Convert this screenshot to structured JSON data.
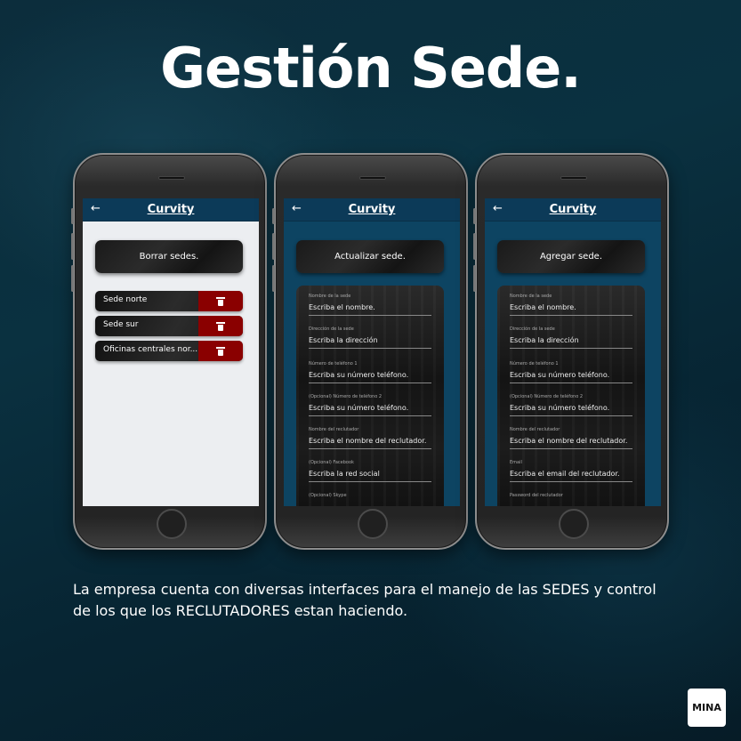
{
  "headline": "Gestión Sede.",
  "caption": "La empresa cuenta con diversas interfaces para el manejo de las SEDES y control de los que los RECLUTADORES estan haciendo.",
  "logo_text": "MINA",
  "phones": [
    {
      "app_title": "Curvity",
      "back_icon": "←",
      "action_button": "Borrar sedes.",
      "sedes": [
        "Sede norte",
        "Sede sur",
        "Oficinas centrales nor..."
      ]
    },
    {
      "app_title": "Curvity",
      "back_icon": "←",
      "action_button": "Actualizar sede.",
      "fields": [
        {
          "label": "Nombre de la sede",
          "placeholder": "Escriba el nombre."
        },
        {
          "label": "Dirección de la sede",
          "placeholder": "Escriba la dirección"
        },
        {
          "label": "Número de teléfono 1",
          "placeholder": "Escriba su número teléfono."
        },
        {
          "label": "(Opcional) Número de teléfono 2",
          "placeholder": "Escriba su número teléfono."
        },
        {
          "label": "Nombre del reclutador",
          "placeholder": "Escriba el nombre del reclutador."
        },
        {
          "label": "(Opcional) Facebook",
          "placeholder": "Escriba la red social"
        },
        {
          "label": "(Opcional) Skype"
        }
      ]
    },
    {
      "app_title": "Curvity",
      "back_icon": "←",
      "action_button": "Agregar sede.",
      "fields": [
        {
          "label": "Nombre de la sede",
          "placeholder": "Escriba el nombre."
        },
        {
          "label": "Dirección de la sede",
          "placeholder": "Escriba la dirección"
        },
        {
          "label": "Número de teléfono 1",
          "placeholder": "Escriba su número teléfono."
        },
        {
          "label": "(Opcional) Número de teléfono 2",
          "placeholder": "Escriba su número teléfono."
        },
        {
          "label": "Nombre del reclutador",
          "placeholder": "Escriba el nombre del reclutador."
        },
        {
          "label": "Email",
          "placeholder": "Escriba el email del reclutador."
        },
        {
          "label": "Password del reclutador"
        }
      ]
    }
  ],
  "colors": {
    "appbar": "#0c3a58",
    "delete": "#8a0000",
    "list_bg": "#eceef1"
  }
}
